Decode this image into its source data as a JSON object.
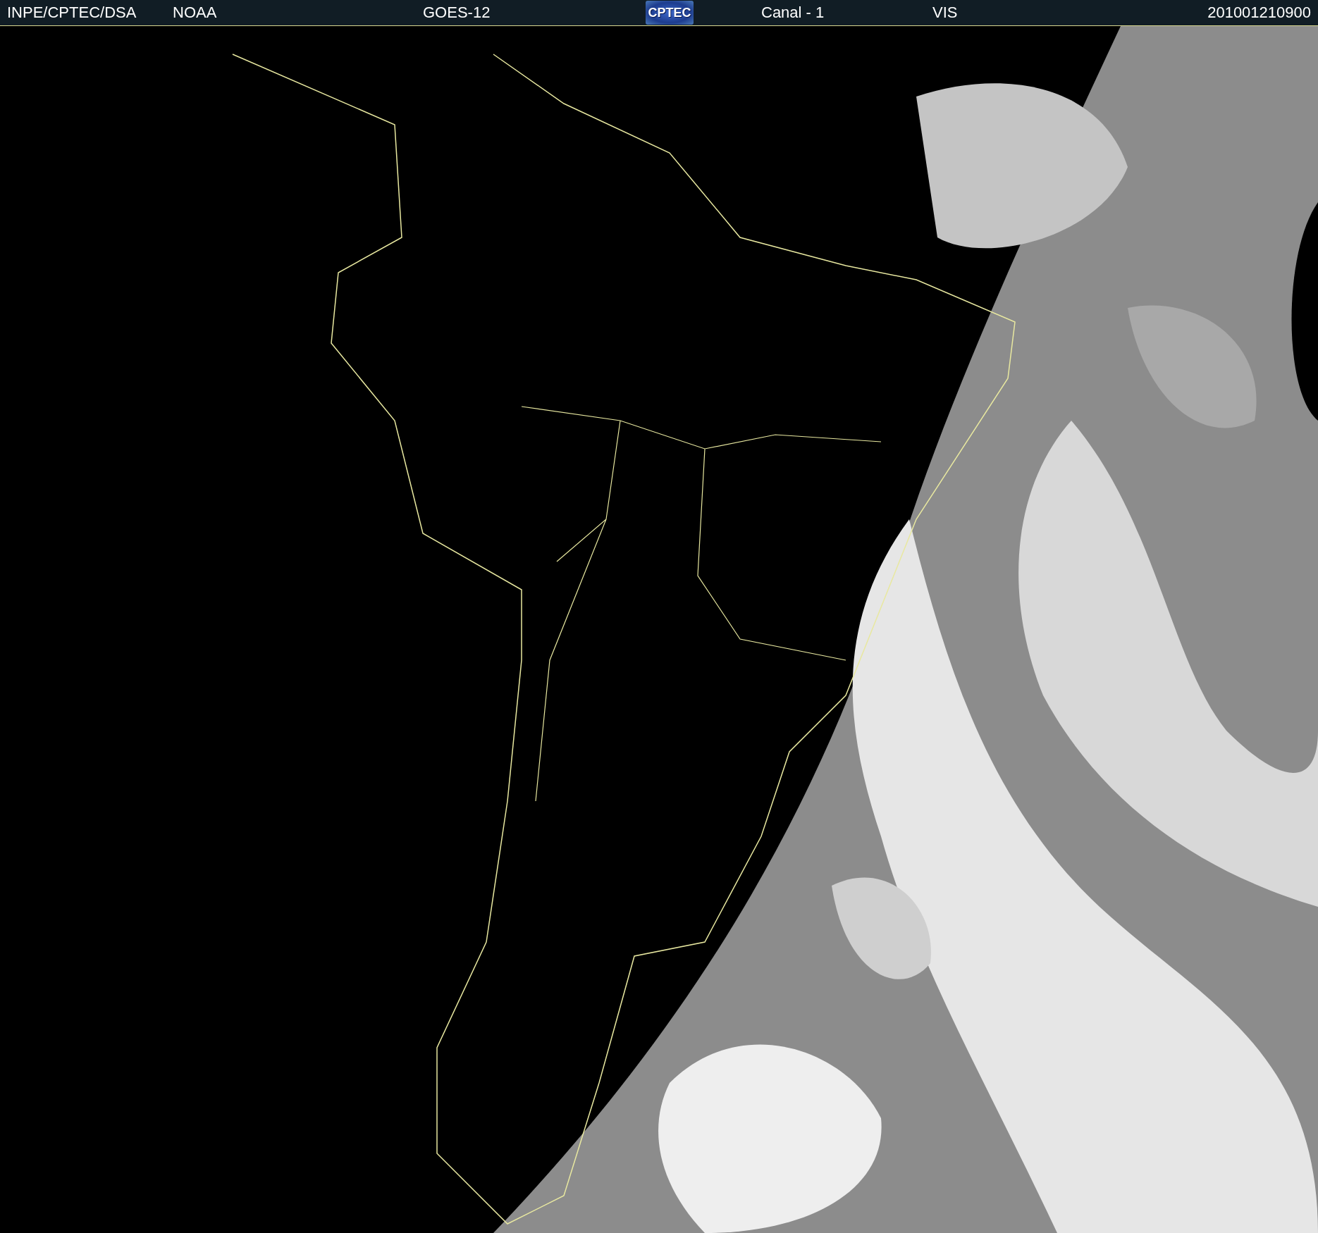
{
  "header": {
    "items": [
      {
        "kind": "text",
        "text": "INPE/CPTEC/DSA"
      },
      {
        "kind": "text",
        "text": "NOAA"
      },
      {
        "kind": "text",
        "text": "GOES-12"
      },
      {
        "kind": "logo",
        "text": "CPTEC"
      },
      {
        "kind": "text",
        "text": "Canal - 1"
      },
      {
        "kind": "text",
        "text": "VIS"
      },
      {
        "kind": "text",
        "text": "201001210900"
      }
    ]
  }
}
